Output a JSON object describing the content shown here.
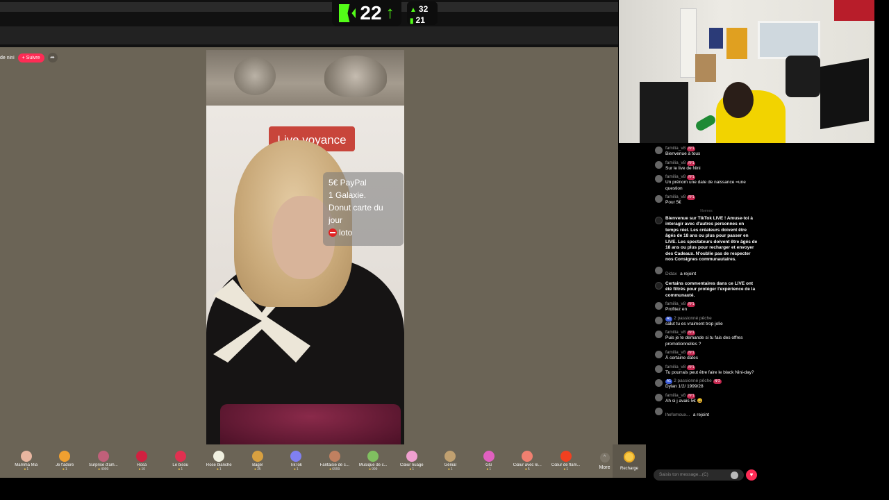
{
  "overlay": {
    "kick_count": "22",
    "stat_top": "32",
    "stat_bottom": "21"
  },
  "host": {
    "name": "de nini",
    "follow_label": "+ Suivre"
  },
  "video": {
    "sign_text": "Live voyance",
    "promo_lines": [
      "5€  PayPal",
      "1 Galaxie.",
      "Donut  carte du",
      "jour",
      "loto"
    ]
  },
  "gifts": [
    {
      "name": "Mamma Mia",
      "price": "1",
      "color": "#e8b6a0"
    },
    {
      "name": "Je t'adore",
      "price": "1",
      "color": "#f0a030"
    },
    {
      "name": "Surprise d'am...",
      "price": "4999",
      "color": "#c0607a"
    },
    {
      "name": "Rosa",
      "price": "10",
      "color": "#d02040"
    },
    {
      "name": "Le bisou",
      "price": "1",
      "color": "#e03050"
    },
    {
      "name": "Rose blanche",
      "price": "1",
      "color": "#f0f0e0"
    },
    {
      "name": "Bagel",
      "price": "35",
      "color": "#d8a040"
    },
    {
      "name": "TikTok",
      "price": "1",
      "color": "#8080f0"
    },
    {
      "name": "Fantaisie de c...",
      "price": "6999",
      "color": "#c08060"
    },
    {
      "name": "Musique de c...",
      "price": "999",
      "color": "#80c060"
    },
    {
      "name": "Cœur nuage",
      "price": "1",
      "color": "#f0a0d0"
    },
    {
      "name": "Génial",
      "price": "1",
      "color": "#c0a070"
    },
    {
      "name": "GG",
      "price": "1",
      "color": "#e060c0"
    },
    {
      "name": "Cœur avec le...",
      "price": "5",
      "color": "#f08070"
    },
    {
      "name": "Cœur de flam...",
      "price": "1",
      "color": "#f04020"
    }
  ],
  "more_label": "More",
  "recharge_label": "Recharge",
  "chat": {
    "messages": [
      {
        "user": "familia_v8",
        "badge": "Nº1",
        "text": "Bienvenue à tous"
      },
      {
        "user": "familia_v8",
        "badge": "Nº1",
        "text": "Sur le live de Nini"
      },
      {
        "user": "familia_v8",
        "badge": "Nº1",
        "text": "Un prénom une date de naissance =une question"
      },
      {
        "user": "familia_v8",
        "badge": "Nº1",
        "text": "Pour 5€"
      }
    ],
    "sys_label": "Normes",
    "system_message": "Bienvenue sur TikTok LIVE ! Amuse-toi à interagir avec d'autres personnes en temps réel. Les créateurs doivent être âgés de 18 ans ou plus pour passer en LIVE. Les spectateurs doivent être âgés de 18 ans ou plus pour recharger et envoyer des Cadeaux. N'oublie pas de respecter nos Consignes communautaires.",
    "join1": {
      "user": "Didax",
      "text": "a rejoint"
    },
    "filter_message": "Certains commentaires dans ce LIVE ont été filtrés pour protéger l'expérience de la communauté.",
    "messages2": [
      {
        "user": "familia_v8",
        "badge": "Nº1",
        "text": "Profitez en"
      },
      {
        "user": "2 passionné pêche",
        "level": "A1",
        "text": "salut tu es vraiment trop jolie"
      },
      {
        "user": "familia_v8",
        "badge": "Nº1",
        "text": "Puis je te demande si tu fais des offres promotionnelles ?"
      },
      {
        "user": "familia_v8",
        "badge": "Nº1",
        "text": "À certaine dates"
      },
      {
        "user": "familia_v8",
        "badge": "Nº1",
        "text": "Tu pourrais peut être faire le black Nini-day?"
      },
      {
        "user": "2 passionné pêche",
        "level": "A1",
        "badge": "Nº2",
        "text": "Dylan 1/2/ 1999/28"
      },
      {
        "user": "familia_v8",
        "badge": "Nº1",
        "text": "Ah si j avais 5€ 😄"
      }
    ],
    "join2": {
      "user": "lhefomoux...",
      "text": "a rejoint"
    },
    "input_placeholder": "Saisis ton message...(C)"
  }
}
